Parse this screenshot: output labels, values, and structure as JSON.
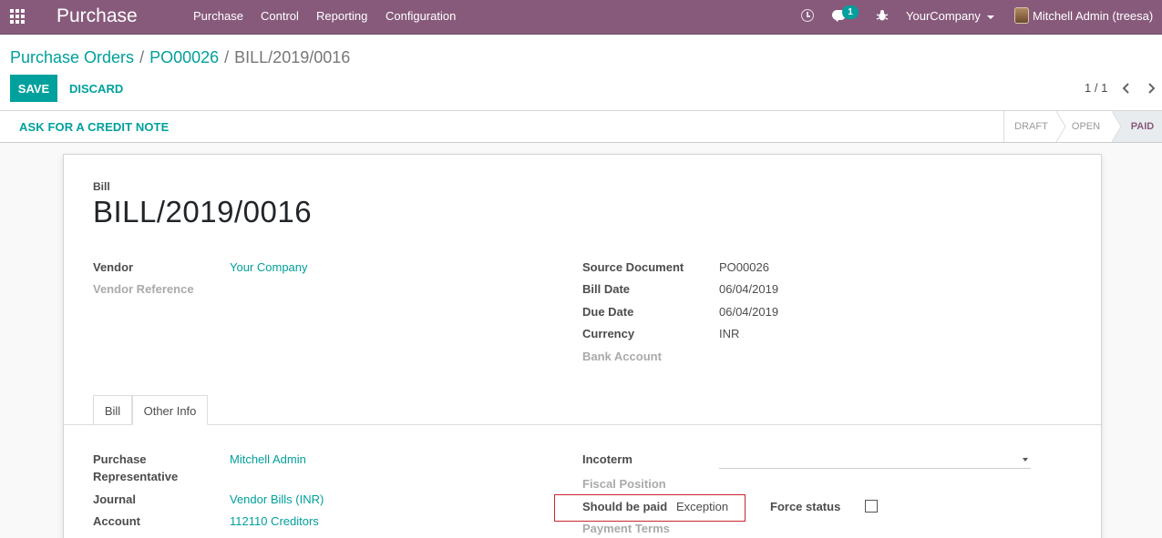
{
  "navbar": {
    "brand": "Purchase",
    "menu": [
      "Purchase",
      "Control",
      "Reporting",
      "Configuration"
    ],
    "chat_badge": "1",
    "company": "YourCompany",
    "user": "Mitchell Admin (treesa)"
  },
  "breadcrumb": {
    "items": [
      "Purchase Orders",
      "PO00026"
    ],
    "current": "BILL/2019/0016"
  },
  "buttons": {
    "save": "SAVE",
    "discard": "DISCARD",
    "credit_note": "ASK FOR A CREDIT NOTE"
  },
  "pager": {
    "value": "1 / 1"
  },
  "stages": [
    "DRAFT",
    "OPEN",
    "PAID"
  ],
  "active_stage": "PAID",
  "sheet": {
    "doc_type": "Bill",
    "title": "BILL/2019/0016",
    "left_fields": [
      {
        "label": "Vendor",
        "value": "Your Company"
      },
      {
        "label": "Vendor Reference",
        "value": ""
      }
    ],
    "right_fields": [
      {
        "label": "Source Document",
        "value": "PO00026"
      },
      {
        "label": "Bill Date",
        "value": "06/04/2019"
      },
      {
        "label": "Due Date",
        "value": "06/04/2019"
      },
      {
        "label": "Currency",
        "value": "INR"
      },
      {
        "label": "Bank Account",
        "value": ""
      }
    ],
    "tabs": [
      "Bill",
      "Other Info"
    ],
    "active_tab": "Other Info",
    "other_info": {
      "purchase_rep_label_1": "Purchase",
      "purchase_rep_label_2": "Representative",
      "purchase_rep_value": "Mitchell Admin",
      "journal_label": "Journal",
      "journal_value": "Vendor Bills (INR)",
      "account_label": "Account",
      "account_value": "112110 Creditors",
      "incoterm_label": "Incoterm",
      "fiscal_position_label": "Fiscal Position",
      "should_be_paid_label": "Should be paid",
      "should_be_paid_value": "Exception",
      "force_status_label": "Force status",
      "payment_terms_label": "Payment Terms"
    }
  },
  "colors": {
    "navbar": "#875a7b",
    "accent": "#00a09d",
    "highlight": "#c9252c"
  }
}
